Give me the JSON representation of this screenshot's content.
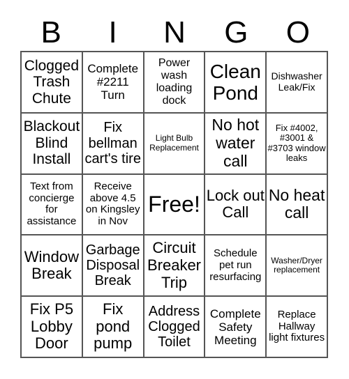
{
  "header": [
    "B",
    "I",
    "N",
    "G",
    "O"
  ],
  "cells": [
    {
      "text": "Clogged Trash Chute",
      "size": 21
    },
    {
      "text": "Complete #2211 Turn",
      "size": 17
    },
    {
      "text": "Power wash loading dock",
      "size": 16
    },
    {
      "text": "Clean Pond",
      "size": 28
    },
    {
      "text": "Dishwasher Leak/Fix",
      "size": 14
    },
    {
      "text": "Blackout Blind Install",
      "size": 21
    },
    {
      "text": "Fix bellman cart's tire",
      "size": 20
    },
    {
      "text": "Light Bulb Replacement",
      "size": 12
    },
    {
      "text": "No hot water call",
      "size": 23
    },
    {
      "text": "Fix #4002, #3001 & #3703 window leaks",
      "size": 13
    },
    {
      "text": "Text from concierge for assistance",
      "size": 15
    },
    {
      "text": "Receive above 4.5 on Kingsley in Nov",
      "size": 15
    },
    {
      "text": "Free!",
      "size": 32
    },
    {
      "text": "Lock out Call",
      "size": 22
    },
    {
      "text": "No heat call",
      "size": 23
    },
    {
      "text": "Window Break",
      "size": 22
    },
    {
      "text": "Garbage Disposal Break",
      "size": 20
    },
    {
      "text": "Circuit Breaker Trip",
      "size": 22
    },
    {
      "text": "Schedule pet run resurfacing",
      "size": 15
    },
    {
      "text": "Washer/Dryer replacement",
      "size": 12
    },
    {
      "text": "Fix P5 Lobby Door",
      "size": 22
    },
    {
      "text": "Fix pond pump",
      "size": 22
    },
    {
      "text": "Address Clogged Toilet",
      "size": 20
    },
    {
      "text": "Complete Safety Meeting",
      "size": 17
    },
    {
      "text": "Replace Hallway light fixtures",
      "size": 15
    }
  ]
}
